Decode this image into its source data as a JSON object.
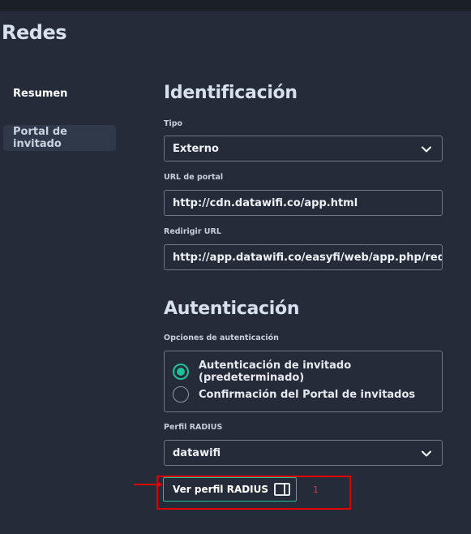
{
  "header": {
    "title": "Redes"
  },
  "sidebar": {
    "items": [
      {
        "label": "Resumen"
      },
      {
        "label": "Portal de invitado"
      }
    ]
  },
  "identification": {
    "heading": "Identificación",
    "type": {
      "label": "Tipo",
      "value": "Externo"
    },
    "portal_url": {
      "label": "URL de portal",
      "value": "http://cdn.datawifi.co/app.html"
    },
    "redirect_url": {
      "label": "Redirigir URL",
      "value": "http://app.datawifi.co/easyfi/web/app.php/redirecci"
    }
  },
  "authentication": {
    "heading": "Autenticación",
    "options_label": "Opciones de autenticación",
    "options": [
      {
        "label": "Autenticación de invitado (predeterminado)",
        "selected": true
      },
      {
        "label": "Confirmación del Portal de invitados",
        "selected": false
      }
    ],
    "radius_profile": {
      "label": "Perfil RADIUS",
      "value": "datawifi"
    },
    "view_button": "Ver perfil RADIUS"
  },
  "annotation": {
    "number": "1",
    "color": "#e00000"
  },
  "colors": {
    "accent": "#1fbf98",
    "background": "#252b38",
    "sidebar_active": "#30394a"
  }
}
